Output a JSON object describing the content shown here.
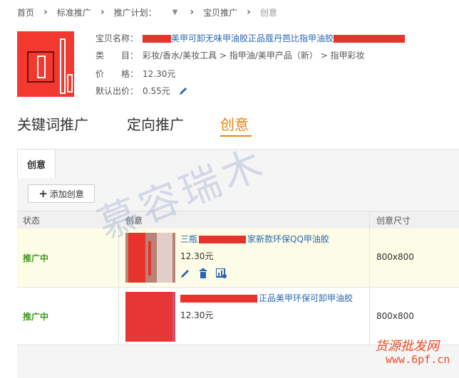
{
  "breadcrumb": {
    "items": [
      "首页",
      "标准推广",
      "推广计划：",
      "宝贝推广",
      "创意"
    ]
  },
  "product": {
    "name_label": "宝贝名称：",
    "name_value": "美甲可卸无味甲油胶正品蔻丹芭比指甲油胶",
    "category_label": "类　　目：",
    "category_value": "彩妆/香水/美妆工具 > 指甲油/美甲产品（新） > 指甲彩妆",
    "price_label": "价　　格：",
    "price_value": "12.30元",
    "bid_label": "默认出价：",
    "bid_value": "0.55元"
  },
  "main_tabs": [
    "关键词推广",
    "定向推广",
    "创意"
  ],
  "sub_tab": "创意",
  "add_button": "添加创意",
  "table": {
    "headers": [
      "状态",
      "创意",
      "创意尺寸"
    ],
    "rows": [
      {
        "status": "推广中",
        "title_prefix": "三瓶",
        "title": "家新款环保QQ甲油胶",
        "price": "12.30元",
        "size": "800x800"
      },
      {
        "status": "推广中",
        "title_prefix": "",
        "title": "正品美甲环保可卸甲油胶",
        "price": "12.30元",
        "size": "800x800"
      }
    ]
  },
  "watermark": {
    "main": "慕容瑞木",
    "site_cn": "货源批发网",
    "site_url": "www.6pf.cn"
  },
  "colors": {
    "accent": "#e8860f",
    "link": "#2a67b1",
    "status": "#3a9a1a",
    "redaction": "#e8322c"
  }
}
